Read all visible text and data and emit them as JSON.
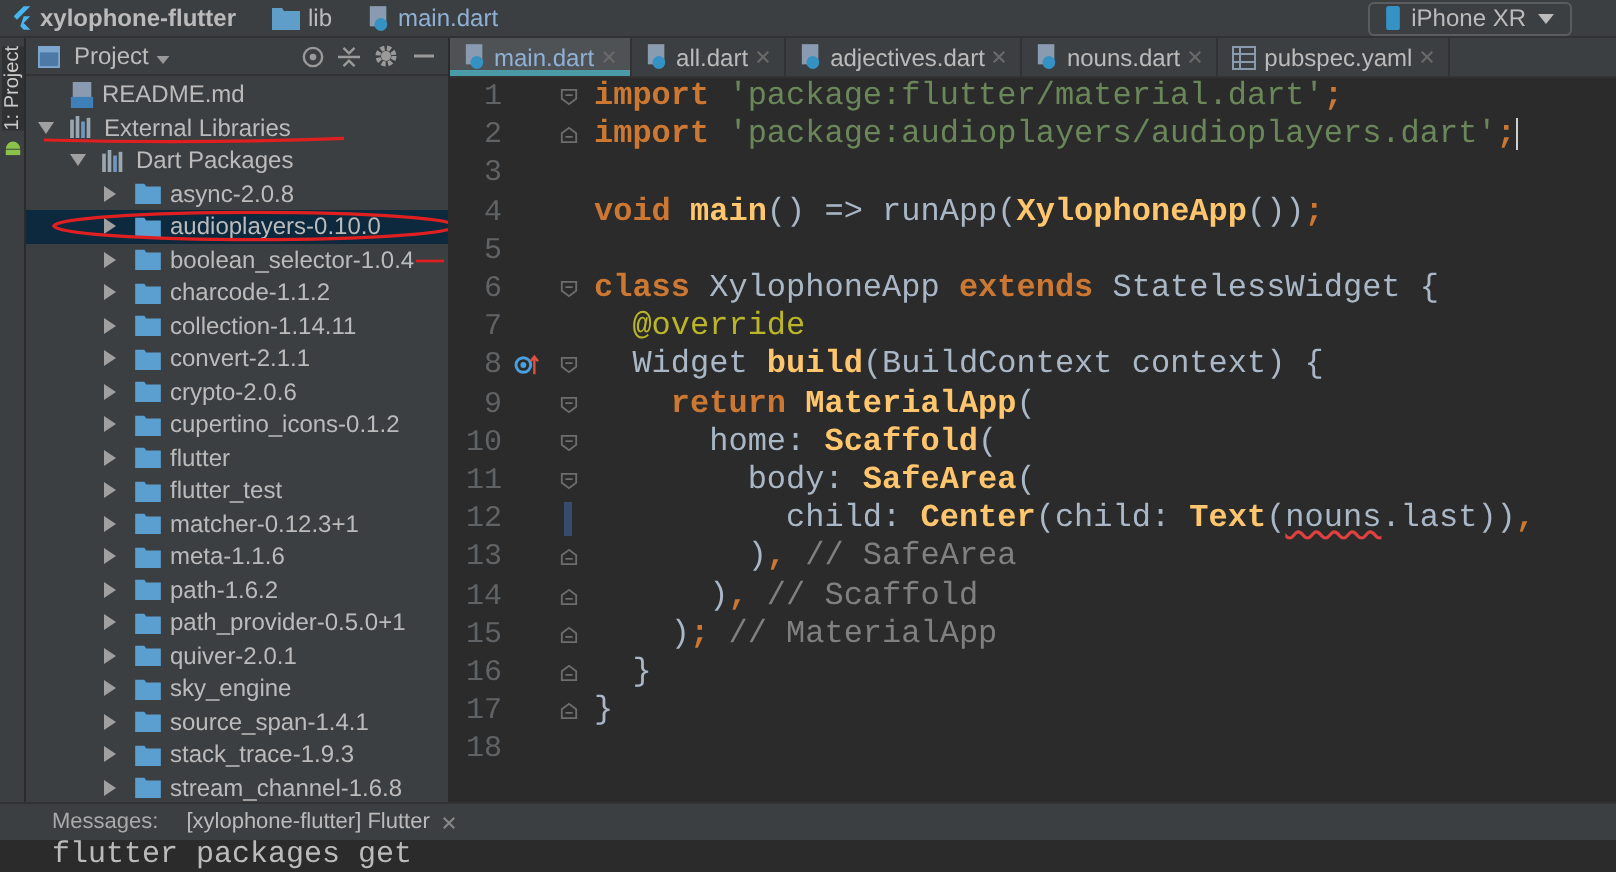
{
  "breadcrumb": [
    {
      "kind": "project",
      "label": "xylophone-flutter"
    },
    {
      "kind": "folder",
      "label": "lib"
    },
    {
      "kind": "dart",
      "label": "main.dart"
    }
  ],
  "device": {
    "label": "iPhone XR"
  },
  "side_strip": {
    "label": "1: Project"
  },
  "project_panel": {
    "title": "Project",
    "tree": [
      {
        "label": "README.md",
        "kind": "markdown"
      },
      {
        "label": "External Libraries",
        "kind": "library",
        "expanded": true,
        "selected": false,
        "annotations": [
          {
            "kind": "underline"
          }
        ],
        "children": [
          {
            "label": "Dart Packages",
            "kind": "library",
            "expanded": true,
            "selected": false,
            "children": [
              {
                "label": "async-2.0.8",
                "kind": "folder",
                "expanded": false,
                "selected": false
              },
              {
                "label": "audioplayers-0.10.0",
                "kind": "folder",
                "expanded": false,
                "selected": true,
                "annotations": [
                  {
                    "kind": "ellipse"
                  }
                ]
              },
              {
                "label": "boolean_selector-1.0.4",
                "kind": "folder",
                "expanded": false,
                "selected": false,
                "annotations": [
                  {
                    "kind": "dash"
                  }
                ]
              },
              {
                "label": "charcode-1.1.2",
                "kind": "folder",
                "expanded": false,
                "selected": false
              },
              {
                "label": "collection-1.14.11",
                "kind": "folder",
                "expanded": false,
                "selected": false
              },
              {
                "label": "convert-2.1.1",
                "kind": "folder",
                "expanded": false,
                "selected": false
              },
              {
                "label": "crypto-2.0.6",
                "kind": "folder",
                "expanded": false,
                "selected": false
              },
              {
                "label": "cupertino_icons-0.1.2",
                "kind": "folder",
                "expanded": false,
                "selected": false
              },
              {
                "label": "flutter",
                "kind": "folder",
                "expanded": false,
                "selected": false
              },
              {
                "label": "flutter_test",
                "kind": "folder",
                "expanded": false,
                "selected": false
              },
              {
                "label": "matcher-0.12.3+1",
                "kind": "folder",
                "expanded": false,
                "selected": false
              },
              {
                "label": "meta-1.1.6",
                "kind": "folder",
                "expanded": false,
                "selected": false
              },
              {
                "label": "path-1.6.2",
                "kind": "folder",
                "expanded": false,
                "selected": false
              },
              {
                "label": "path_provider-0.5.0+1",
                "kind": "folder",
                "expanded": false,
                "selected": false
              },
              {
                "label": "quiver-2.0.1",
                "kind": "folder",
                "expanded": false,
                "selected": false
              },
              {
                "label": "sky_engine",
                "kind": "folder",
                "expanded": false,
                "selected": false
              },
              {
                "label": "source_span-1.4.1",
                "kind": "folder",
                "expanded": false,
                "selected": false
              },
              {
                "label": "stack_trace-1.9.3",
                "kind": "folder",
                "expanded": false,
                "selected": false
              },
              {
                "label": "stream_channel-1.6.8",
                "kind": "folder",
                "expanded": false,
                "selected": false
              }
            ]
          }
        ]
      }
    ]
  },
  "tabs": [
    {
      "label": "main.dart",
      "kind": "dart",
      "selected": true
    },
    {
      "label": "all.dart",
      "kind": "dart",
      "selected": false
    },
    {
      "label": "adjectives.dart",
      "kind": "dart",
      "selected": false
    },
    {
      "label": "nouns.dart",
      "kind": "dart",
      "selected": false
    },
    {
      "label": "pubspec.yaml",
      "kind": "yaml",
      "selected": false
    }
  ],
  "code": [
    {
      "number": "1",
      "gutter": [
        {
          "kind": "fold-start"
        }
      ],
      "tokens": [
        {
          "kind": "keyword",
          "text": "import "
        },
        {
          "kind": "string",
          "text": "'package:flutter/material.dart'"
        },
        {
          "kind": "keyword",
          "text": ";"
        }
      ]
    },
    {
      "number": "2",
      "gutter": [
        {
          "kind": "fold-end"
        }
      ],
      "cursor": true,
      "tokens": [
        {
          "kind": "keyword",
          "text": "import "
        },
        {
          "kind": "string",
          "text": "'package:audioplayers/audioplayers.dart'"
        },
        {
          "kind": "keyword",
          "text": ";"
        }
      ]
    },
    {
      "number": "3"
    },
    {
      "number": "4",
      "tokens": [
        {
          "kind": "keyword",
          "text": "void "
        },
        {
          "kind": "function",
          "text": "main"
        },
        {
          "kind": "plain",
          "text": "() => runApp("
        },
        {
          "kind": "function",
          "text": "XylophoneApp"
        },
        {
          "kind": "plain",
          "text": "())"
        },
        {
          "kind": "keyword",
          "text": ";"
        }
      ]
    },
    {
      "number": "5"
    },
    {
      "number": "6",
      "gutter": [
        {
          "kind": "fold-start"
        }
      ],
      "tokens": [
        {
          "kind": "keyword",
          "text": "class "
        },
        {
          "kind": "plain",
          "text": "XylophoneApp "
        },
        {
          "kind": "keyword",
          "text": "extends "
        },
        {
          "kind": "plain",
          "text": "StatelessWidget {"
        }
      ]
    },
    {
      "number": "7",
      "tokens": [
        {
          "kind": "annotation",
          "text": "  @override"
        }
      ]
    },
    {
      "number": "8",
      "gutter": [
        {
          "kind": "override"
        },
        {
          "kind": "fold-start"
        }
      ],
      "tokens": [
        {
          "kind": "plain",
          "text": "  Widget "
        },
        {
          "kind": "function",
          "text": "build"
        },
        {
          "kind": "plain",
          "text": "(BuildContext context) {"
        }
      ]
    },
    {
      "number": "9",
      "gutter": [
        {
          "kind": "fold-start"
        }
      ],
      "tokens": [
        {
          "kind": "keyword",
          "text": "    return "
        },
        {
          "kind": "function",
          "text": "MaterialApp"
        },
        {
          "kind": "plain",
          "text": "("
        }
      ]
    },
    {
      "number": "10",
      "gutter": [
        {
          "kind": "fold-start"
        }
      ],
      "tokens": [
        {
          "kind": "plain",
          "text": "      home: "
        },
        {
          "kind": "function",
          "text": "Scaffold"
        },
        {
          "kind": "plain",
          "text": "("
        }
      ]
    },
    {
      "number": "11",
      "gutter": [
        {
          "kind": "fold-start"
        }
      ],
      "tokens": [
        {
          "kind": "plain",
          "text": "        body: "
        },
        {
          "kind": "function",
          "text": "SafeArea"
        },
        {
          "kind": "plain",
          "text": "("
        }
      ]
    },
    {
      "number": "12",
      "gutter": [
        {
          "kind": "change"
        }
      ],
      "tokens": [
        {
          "kind": "plain",
          "text": "          child: "
        },
        {
          "kind": "function",
          "text": "Center"
        },
        {
          "kind": "plain",
          "text": "(child: "
        },
        {
          "kind": "function",
          "text": "Text"
        },
        {
          "kind": "plain",
          "text": "("
        },
        {
          "kind": "error",
          "text": "nouns"
        },
        {
          "kind": "plain",
          "text": ".last))"
        },
        {
          "kind": "keyword",
          "text": ","
        }
      ]
    },
    {
      "number": "13",
      "gutter": [
        {
          "kind": "fold-end"
        }
      ],
      "tokens": [
        {
          "kind": "plain",
          "text": "        )"
        },
        {
          "kind": "keyword",
          "text": ", "
        },
        {
          "kind": "comment",
          "text": "// SafeArea"
        }
      ]
    },
    {
      "number": "14",
      "gutter": [
        {
          "kind": "fold-end"
        }
      ],
      "tokens": [
        {
          "kind": "plain",
          "text": "      )"
        },
        {
          "kind": "keyword",
          "text": ", "
        },
        {
          "kind": "comment",
          "text": "// Scaffold"
        }
      ]
    },
    {
      "number": "15",
      "gutter": [
        {
          "kind": "fold-end"
        }
      ],
      "tokens": [
        {
          "kind": "plain",
          "text": "    )"
        },
        {
          "kind": "keyword",
          "text": "; "
        },
        {
          "kind": "comment",
          "text": "// MaterialApp"
        }
      ]
    },
    {
      "number": "16",
      "gutter": [
        {
          "kind": "fold-end"
        }
      ],
      "tokens": [
        {
          "kind": "plain",
          "text": "  }"
        }
      ]
    },
    {
      "number": "17",
      "gutter": [
        {
          "kind": "fold-end"
        }
      ],
      "tokens": [
        {
          "kind": "plain",
          "text": "}"
        }
      ]
    },
    {
      "number": "18"
    }
  ],
  "messages": {
    "label": "Messages:",
    "tab": "[xylophone-flutter] Flutter",
    "output": "flutter packages get"
  }
}
